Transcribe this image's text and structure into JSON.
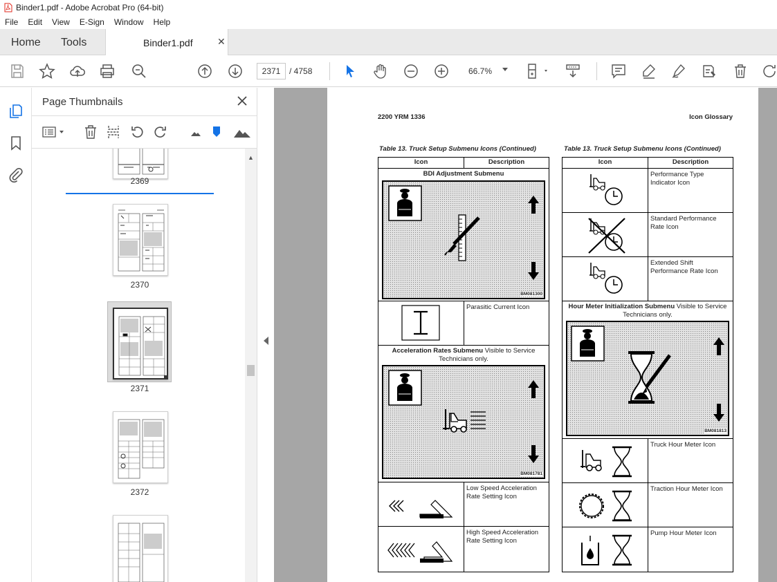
{
  "window": {
    "title": "Binder1.pdf - Adobe Acrobat Pro (64-bit)"
  },
  "menu": [
    "File",
    "Edit",
    "View",
    "E-Sign",
    "Window",
    "Help"
  ],
  "tabs": {
    "home": "Home",
    "tools": "Tools",
    "document": "Binder1.pdf"
  },
  "toolbar": {
    "current_page": "2371",
    "total_pages": "/ 4758",
    "zoom": "66.7%"
  },
  "panel": {
    "title": "Page Thumbnails",
    "thumbnails": [
      {
        "label": "2369"
      },
      {
        "label": "2370"
      },
      {
        "label": "2371",
        "selected": true
      },
      {
        "label": "2372"
      },
      {
        "label": ""
      }
    ]
  },
  "document": {
    "header_left": "2200 YRM 1336",
    "header_right": "Icon Glossary",
    "left_table": {
      "caption": "Table 13. Truck Setup Submenu Icons (Continued)",
      "col_icon": "Icon",
      "col_desc": "Description",
      "bdi_title": "BDI Adjustment Submenu",
      "bdi_code": "BM081300",
      "parasitic": "Parasitic Current Icon",
      "accel_title": "Acceleration Rates Submenu",
      "accel_note": " Visible to Service Technicians only.",
      "accel_code": "BM081781",
      "low_speed": "Low Speed Acceleration Rate Setting Icon",
      "high_speed": "High Speed Acceleration Rate Setting Icon"
    },
    "right_table": {
      "caption": "Table 13. Truck Setup Submenu Icons (Continued)",
      "col_icon": "Icon",
      "col_desc": "Description",
      "perf_type": "Performance Type Indicator Icon",
      "std_perf": "Standard Performance Rate Icon",
      "ext_shift": "Extended Shift Performance Rate Icon",
      "hour_title": "Hour Meter Initialization Submenu",
      "hour_note": " Visible to Service Technicians only.",
      "hour_code": "BM081813",
      "truck_hour": "Truck Hour Meter Icon",
      "traction_hour": "Traction Hour Meter Icon",
      "pump_hour": "Pump Hour Meter Icon"
    }
  },
  "colors": {
    "accent": "#1473e6",
    "pdf_red": "#e0281c"
  }
}
